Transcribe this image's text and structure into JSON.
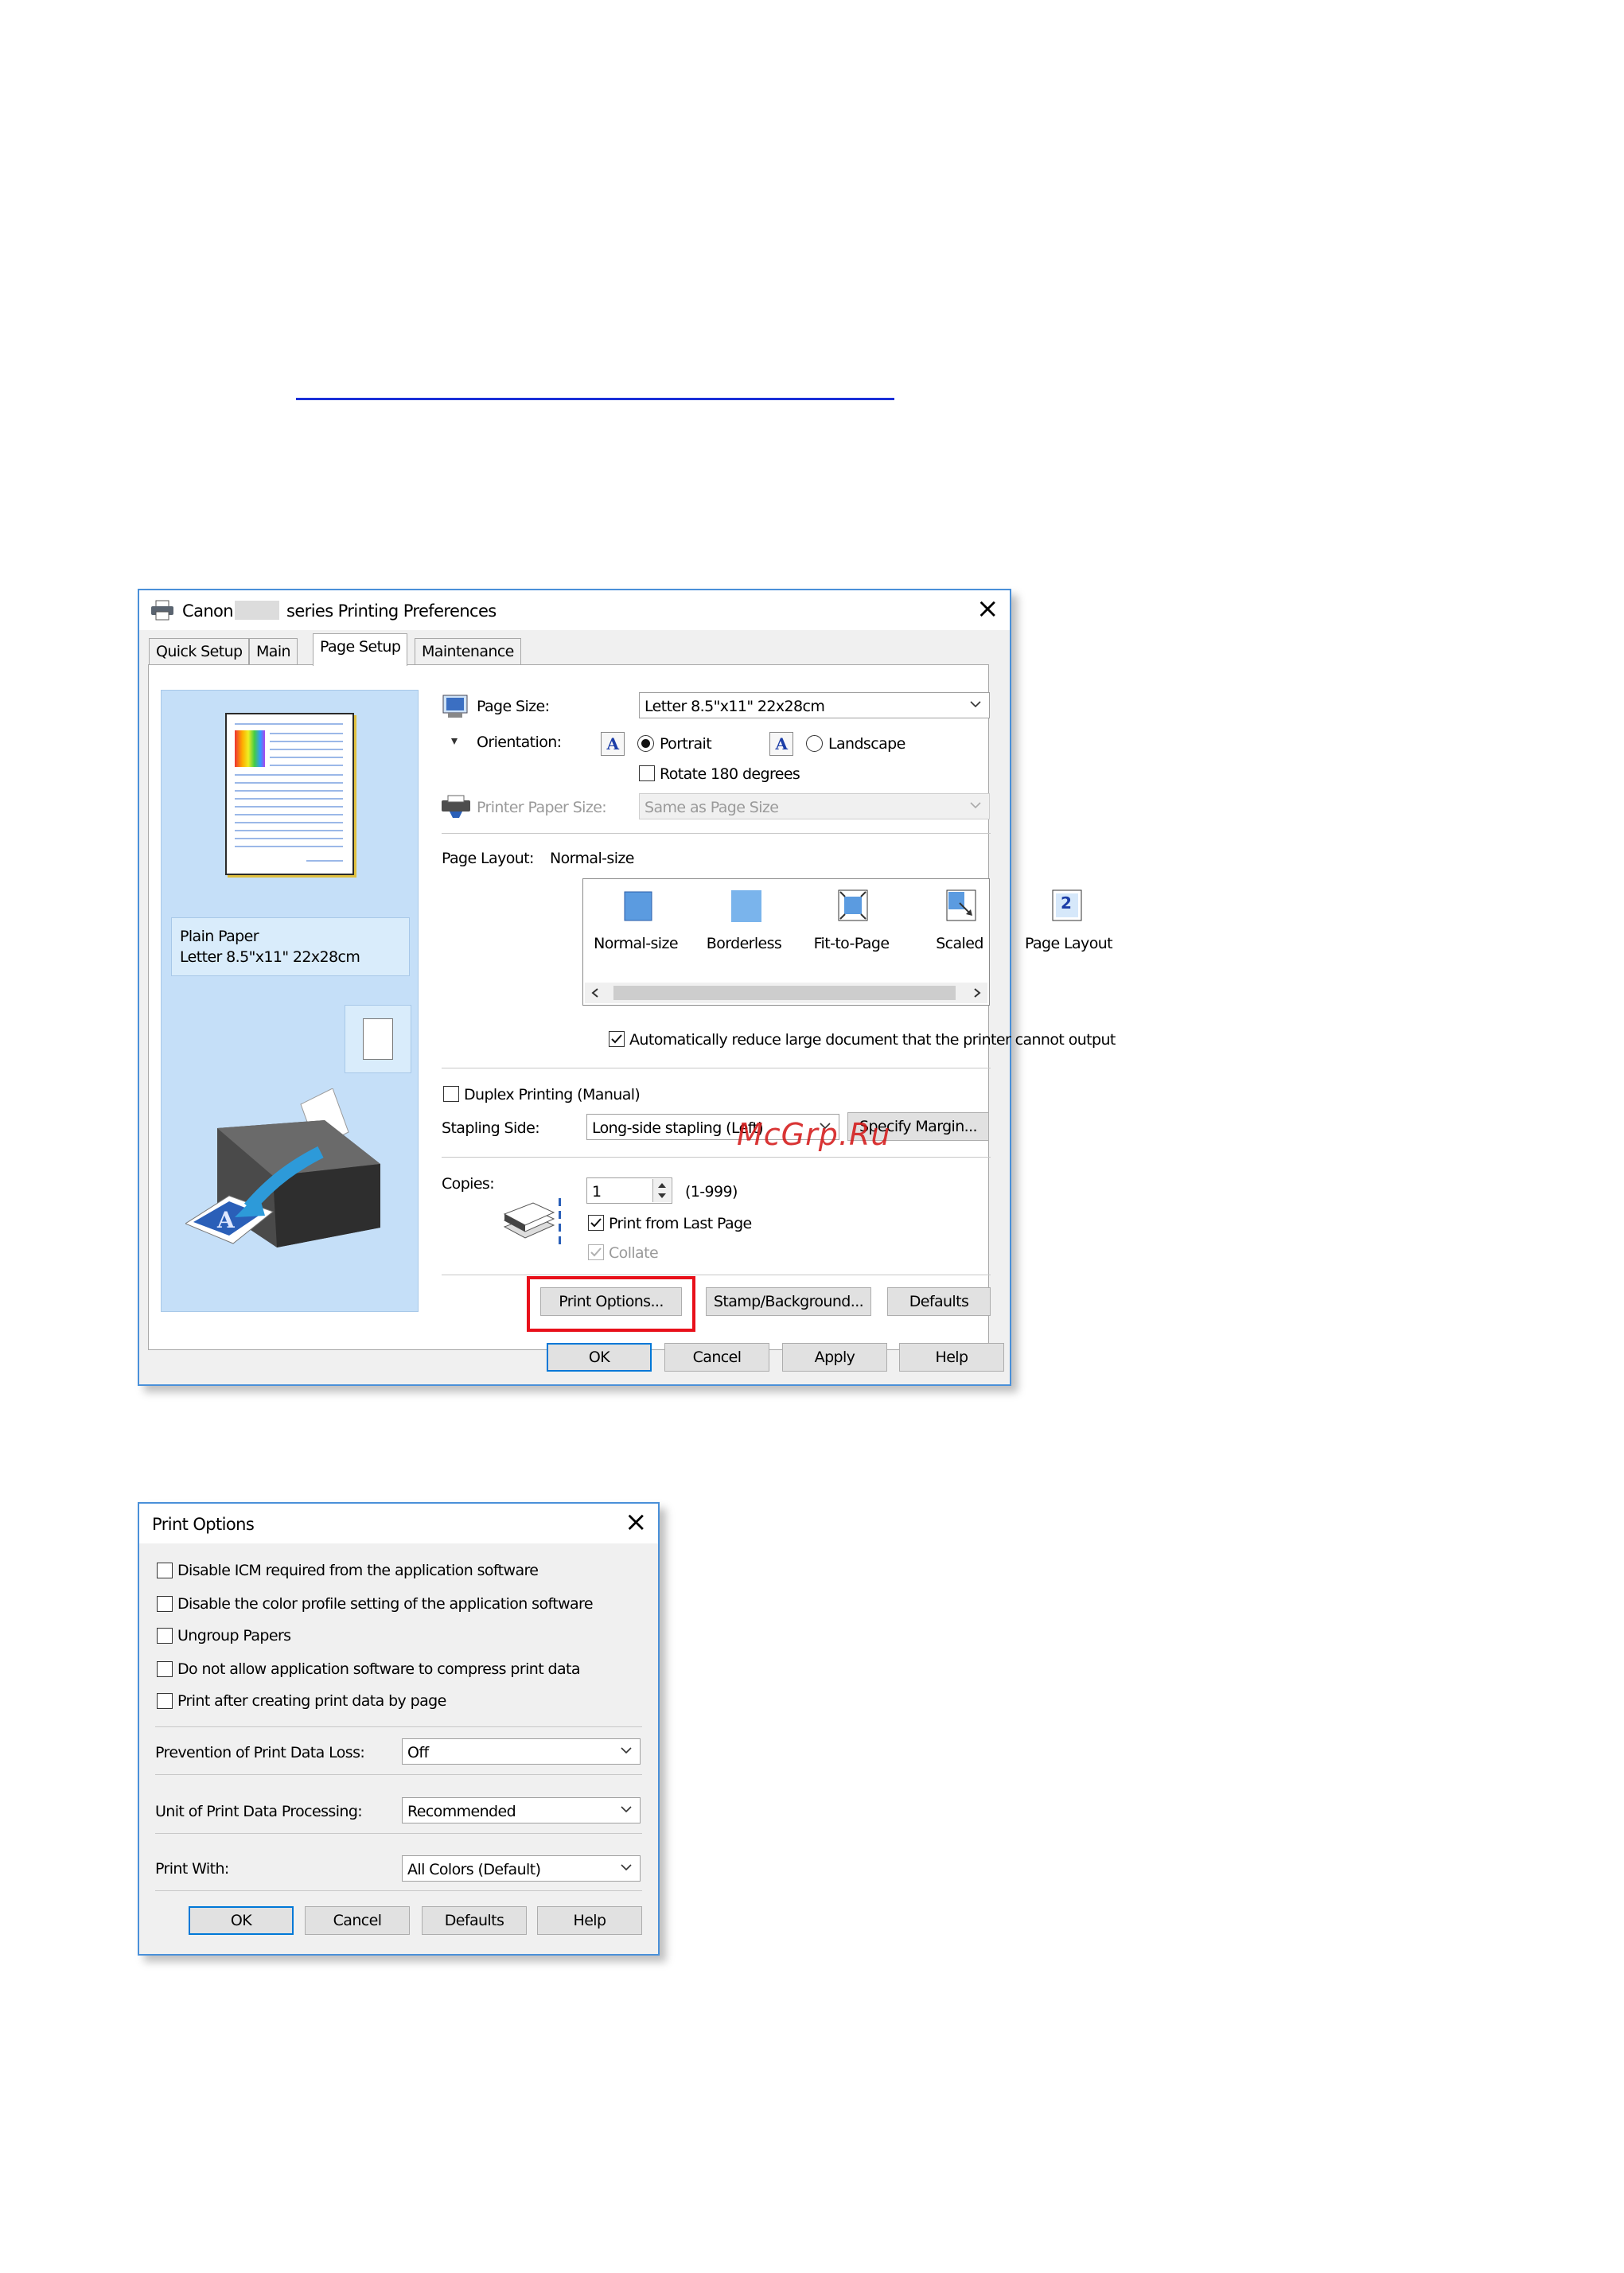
{
  "dialog_main": {
    "title_brand": "Canon",
    "title_rest": "series Printing Preferences",
    "tabs": [
      "Quick Setup",
      "Main",
      "Page Setup",
      "Maintenance"
    ],
    "active_tab": "Page Setup",
    "preview": {
      "media_type": "Plain Paper",
      "paper_size": "Letter 8.5\"x11\" 22x28cm"
    },
    "page_size": {
      "label": "Page Size:",
      "value": "Letter 8.5\"x11\" 22x28cm"
    },
    "orientation": {
      "label": "Orientation:",
      "portrait": "Portrait",
      "landscape": "Landscape",
      "selected": "Portrait",
      "rotate": "Rotate 180 degrees",
      "icon_glyph": "A"
    },
    "printer_paper_size": {
      "label": "Printer Paper Size:",
      "value": "Same as Page Size"
    },
    "page_layout": {
      "label": "Page Layout:",
      "current": "Normal-size",
      "items": [
        "Normal-size",
        "Borderless",
        "Fit-to-Page",
        "Scaled",
        "Page Layout"
      ],
      "page_layout_icon_number": "2"
    },
    "auto_reduce": "Automatically reduce large document that the printer cannot output",
    "duplex": "Duplex Printing (Manual)",
    "stapling": {
      "label": "Stapling Side:",
      "value": "Long-side stapling (Left)",
      "margin_button": "Specify Margin..."
    },
    "copies": {
      "label": "Copies:",
      "value": "1",
      "range": "(1-999)",
      "print_from_last": "Print from Last Page",
      "collate": "Collate"
    },
    "buttons": {
      "print_options": "Print Options...",
      "stamp": "Stamp/Background...",
      "defaults": "Defaults"
    },
    "footer": {
      "ok": "OK",
      "cancel": "Cancel",
      "apply": "Apply",
      "help": "Help"
    },
    "colors": {
      "highlight": "#e8101a",
      "accent": "#0078d7",
      "preview_bg": "#c5dff8"
    }
  },
  "watermark": "McGrp.Ru",
  "dialog_options": {
    "title": "Print Options",
    "checkboxes": [
      "Disable ICM required from the application software",
      "Disable the color profile setting of the application software",
      "Ungroup Papers",
      "Do not allow application software to compress print data",
      "Print after creating print data by page"
    ],
    "prevention": {
      "label": "Prevention of Print Data Loss:",
      "value": "Off"
    },
    "unit": {
      "label": "Unit of Print Data Processing:",
      "value": "Recommended"
    },
    "print_with": {
      "label": "Print With:",
      "value": "All Colors (Default)"
    },
    "footer": {
      "ok": "OK",
      "cancel": "Cancel",
      "defaults": "Defaults",
      "help": "Help"
    }
  }
}
